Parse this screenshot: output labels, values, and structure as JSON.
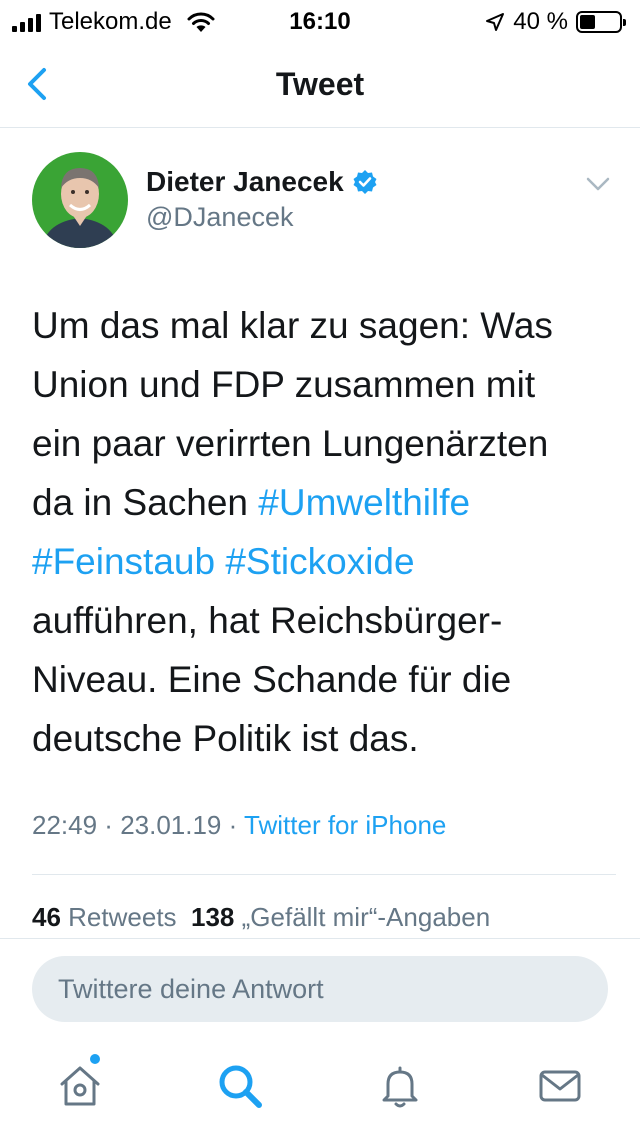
{
  "status_bar": {
    "carrier": "Telekom.de",
    "time": "16:10",
    "battery_percent": "40 %",
    "battery_level": 0.4
  },
  "nav": {
    "title": "Tweet",
    "back_icon": "chevron-left-icon"
  },
  "tweet": {
    "author_name": "Dieter Janecek",
    "handle": "@DJanecek",
    "verified": true,
    "text_lines": [
      {
        "plain": "Um das mal klar zu sagen: Was"
      },
      {
        "plain": "Union und FDP zusammen mit"
      },
      {
        "plain": "ein paar verirrten Lungenärzten"
      },
      {
        "plain": "da in Sachen ",
        "tag1": "#Umwelthilfe"
      },
      {
        "tag1": "#Feinstaub",
        "sep": " ",
        "tag2": "#Stickoxide"
      },
      {
        "plain": "aufführen, hat Reichsbürger-"
      },
      {
        "plain": "Niveau. Eine Schande für die"
      },
      {
        "plain": "deutsche Politik ist das."
      }
    ],
    "time": "22:49",
    "date": "23.01.19",
    "source": "Twitter for iPhone"
  },
  "stats": {
    "retweets_count": "46",
    "retweets_label": "Retweets",
    "likes_count": "138",
    "likes_label": "„Gefällt mir“-Angaben"
  },
  "reply": {
    "placeholder": "Twittere deine Antwort"
  },
  "tabbar": {
    "items": [
      "home-icon",
      "search-icon",
      "notifications-icon",
      "messages-icon"
    ],
    "active": "search-icon"
  },
  "colors": {
    "accent": "#1da1f2",
    "text": "#14171a",
    "secondary": "#657786",
    "avatar_bg": "#3aa435"
  }
}
